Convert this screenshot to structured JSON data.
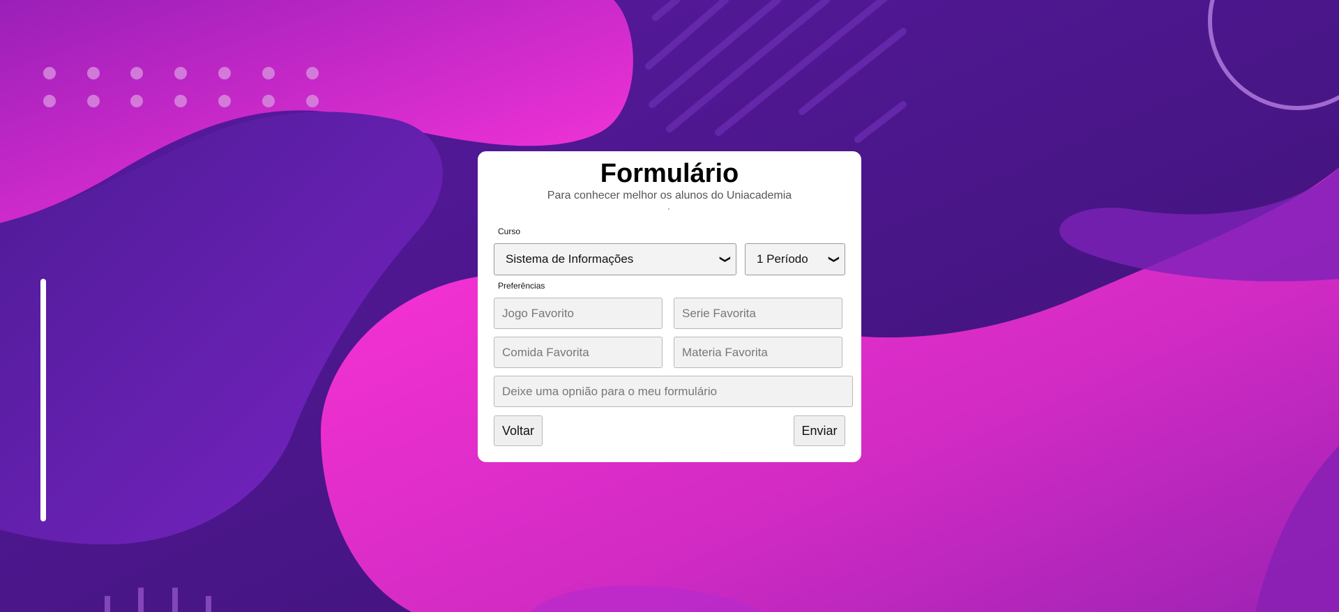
{
  "form": {
    "title": "Formulário",
    "subtitle": "Para conhecer melhor os alunos do Uniacademia",
    "curso_label": "Curso",
    "curso_value": "Sistema de Informações",
    "periodo_value": "1 Período",
    "preferencias_label": "Preferências",
    "jogo_placeholder": "Jogo Favorito",
    "serie_placeholder": "Serie Favorita",
    "comida_placeholder": "Comida Favorita",
    "materia_placeholder": "Materia Favorita",
    "opiniao_placeholder": "Deixe uma opnião para o meu formulário",
    "voltar_label": "Voltar",
    "enviar_label": "Enviar"
  },
  "icons": {
    "select_chevron": "chevron-down-icon"
  },
  "colors": {
    "background_dark": "#3d1678",
    "background_purple": "#6a1bb5",
    "accent_pink": "#ff2fcf",
    "card": "#ffffff"
  }
}
